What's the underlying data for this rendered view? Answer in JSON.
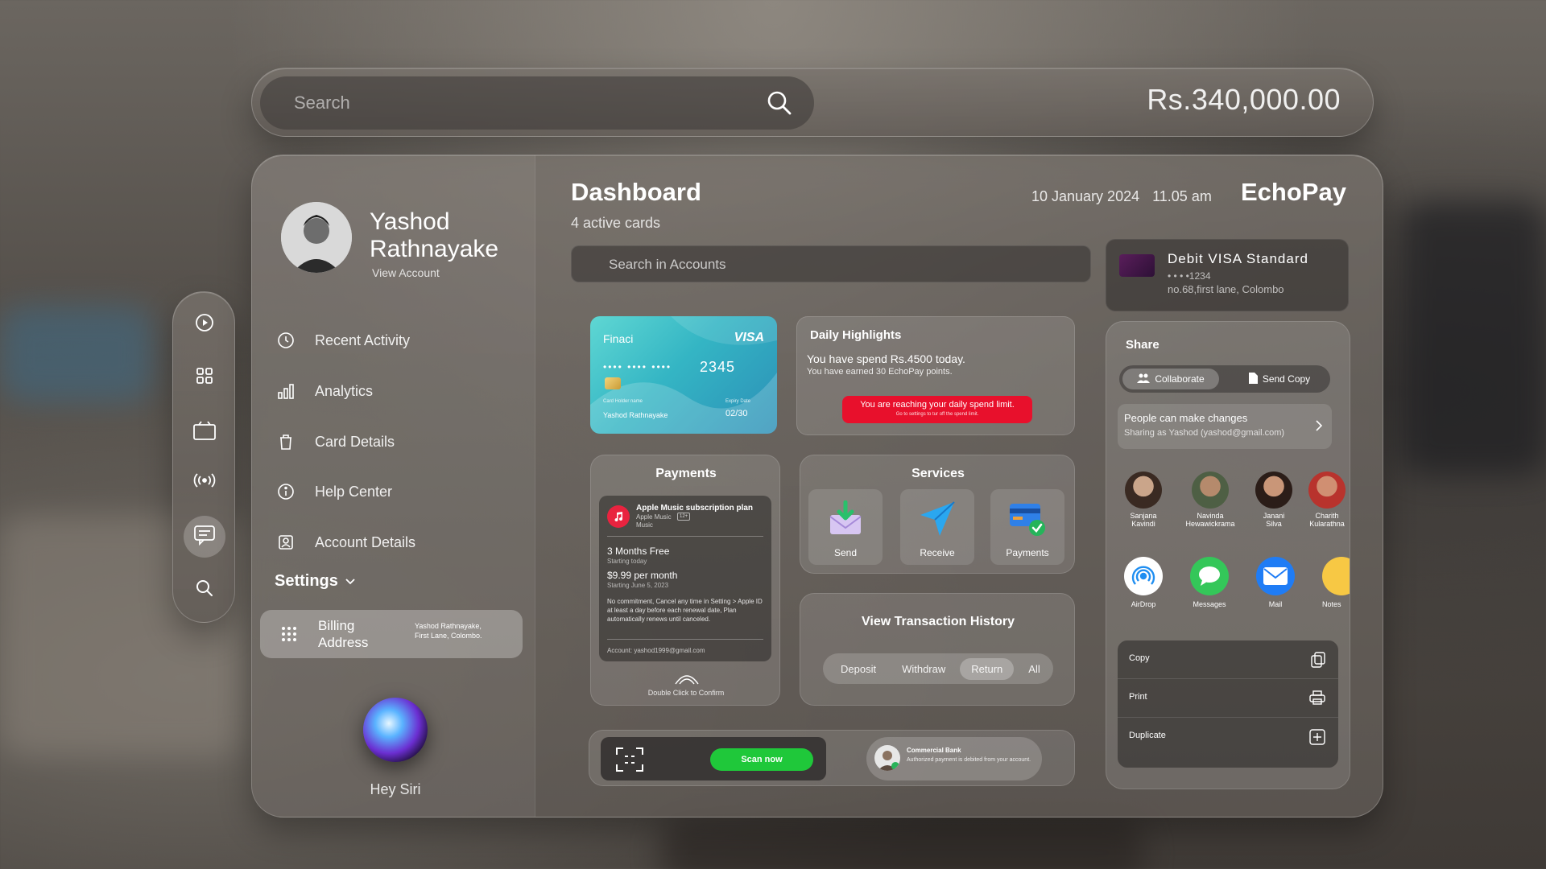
{
  "topbar": {
    "search_placeholder": "Search",
    "balance": "Rs.340,000.00"
  },
  "profile": {
    "first_name": "Yashod",
    "last_name": "Rathnayake",
    "view_account": "View Account"
  },
  "nav": [
    {
      "label": "Recent Activity",
      "icon": "clock-icon"
    },
    {
      "label": "Analytics",
      "icon": "bar-chart-icon"
    },
    {
      "label": "Card Details",
      "icon": "trash-icon"
    },
    {
      "label": "Help Center",
      "icon": "info-icon"
    },
    {
      "label": "Account Details",
      "icon": "contact-icon"
    }
  ],
  "settings": {
    "label": "Settings",
    "billing_label": "Billing Address",
    "billing_value": "Yashod Rathnayake, First Lane, Colombo."
  },
  "siri": {
    "label": "Hey Siri"
  },
  "dashboard": {
    "title": "Dashboard",
    "subtitle": "4 active cards",
    "date": "10 January 2024",
    "time": "11.05 am",
    "brand": "EchoPay",
    "search_placeholder": "Search in Accounts"
  },
  "card": {
    "bank": "Finaci",
    "network": "VISA",
    "masked": "•••• •••• ••••",
    "last4": "2345",
    "holder_label": "Card Holder name",
    "holder": "Yashod Rathnayake",
    "expiry_label": "Expiry Date",
    "expiry": "02/30"
  },
  "highlights": {
    "title": "Daily Highlights",
    "line1": "You have spend Rs.4500 today.",
    "line2": "You have earned 30 EchoPay points.",
    "alert": "You are reaching your daily spend limit.",
    "alert_sub": "Go to settings to tur off the spend limit."
  },
  "payments": {
    "title": "Payments",
    "plan_title": "Apple Music subscription plan",
    "plan_sub1": "Apple Music",
    "plan_badge": "12+",
    "plan_sub2": "Music",
    "free": "3 Months Free",
    "free_sub": "Starting today",
    "price": "$9.99 per month",
    "price_sub": "Starting June 5, 2023",
    "terms": "No commitment, Cancel any time in Setting > Apple ID at least a day before each renewal date, Plan automatically renews until canceled.",
    "account": "Account: yashod1999@gmail.com",
    "confirm": "Double Click to Confirm"
  },
  "services": {
    "title": "Services",
    "items": [
      {
        "label": "Send",
        "icon": "send-envelope-icon"
      },
      {
        "label": "Receive",
        "icon": "paper-plane-icon"
      },
      {
        "label": "Payments",
        "icon": "card-check-icon"
      }
    ]
  },
  "history": {
    "title": "View Transaction History",
    "options": [
      "Deposit",
      "Withdraw",
      "Return",
      "All"
    ],
    "active": "Return"
  },
  "scan": {
    "button": "Scan now"
  },
  "notification": {
    "title": "Commercial Bank",
    "body": "Authorized payment is debited from your account."
  },
  "debit": {
    "title": "Debit VISA Standard",
    "masked": "• • • •1234",
    "address": "no.68,first lane, Colombo"
  },
  "share": {
    "title": "Share",
    "collaborate": "Collaborate",
    "send_copy": "Send Copy",
    "perm_title": "People can make changes",
    "perm_sub": "Sharing as Yashod (yashod@gmail.com)",
    "people": [
      {
        "name1": "Sanjana",
        "name2": "Kavindi"
      },
      {
        "name1": "Navinda",
        "name2": "Hewawickrama"
      },
      {
        "name1": "Janani",
        "name2": "Silva"
      },
      {
        "name1": "Charith",
        "name2": "Kularathna"
      }
    ],
    "apps": [
      {
        "label": "AirDrop",
        "icon": "airdrop-icon",
        "color": "#ffffff"
      },
      {
        "label": "Messages",
        "icon": "messages-icon",
        "color": "#34c759"
      },
      {
        "label": "Mail",
        "icon": "mail-icon",
        "color": "#1f7cf5"
      },
      {
        "label": "Notes",
        "icon": "notes-icon",
        "color": "#f7c844"
      }
    ],
    "actions": [
      {
        "label": "Copy",
        "icon": "copy-icon"
      },
      {
        "label": "Print",
        "icon": "print-icon"
      },
      {
        "label": "Duplicate",
        "icon": "add-square-icon"
      }
    ]
  },
  "colors": {
    "accent_green": "#1fc83a",
    "alert_red": "#e8102c",
    "card_teal": "#3cc6c9"
  }
}
